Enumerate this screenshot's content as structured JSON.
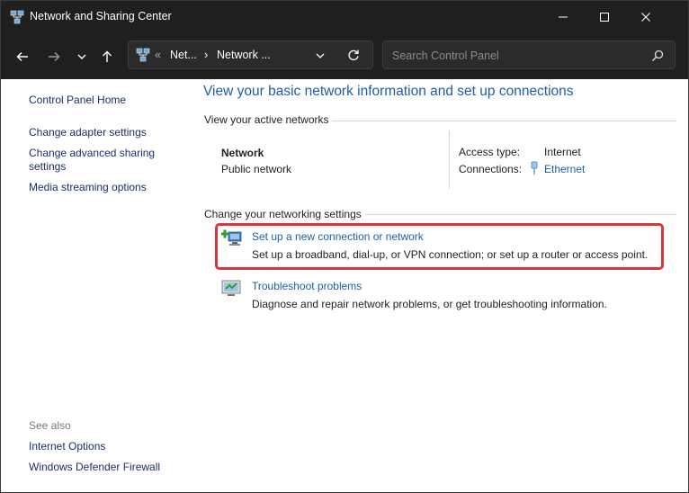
{
  "window": {
    "title": "Network and Sharing Center",
    "minimize_glyph": "—",
    "maximize_glyph": "☐",
    "close_glyph": "✕"
  },
  "address": {
    "overflow": "«",
    "crumb1": "Net...",
    "separator": "›",
    "crumb2": "Network ..."
  },
  "search": {
    "placeholder": "Search Control Panel"
  },
  "sidebar": {
    "home": "Control Panel Home",
    "links": [
      "Change adapter settings",
      "Change advanced sharing settings",
      "Media streaming options"
    ],
    "see_also": "See also",
    "see_also_links": [
      "Internet Options",
      "Windows Defender Firewall"
    ]
  },
  "main": {
    "heading": "View your basic network information and set up connections",
    "active_networks_label": "View your active networks",
    "network": {
      "name": "Network",
      "type": "Public network",
      "access_type_label": "Access type:",
      "access_type_value": "Internet",
      "connections_label": "Connections:",
      "connections_value": "Ethernet"
    },
    "change_settings_label": "Change your networking settings",
    "tasks": [
      {
        "title": "Set up a new connection or network",
        "description": "Set up a broadband, dial-up, or VPN connection; or set up a router or access point.",
        "icon": "new-connection-icon"
      },
      {
        "title": "Troubleshoot problems",
        "description": "Diagnose and repair network problems, or get troubleshooting information.",
        "icon": "troubleshoot-icon"
      }
    ]
  },
  "colors": {
    "link": "#1c5fa8",
    "sidebar_link": "#1a2f6b",
    "highlight": "#d9353a",
    "titlebar": "#1f1f1f"
  }
}
